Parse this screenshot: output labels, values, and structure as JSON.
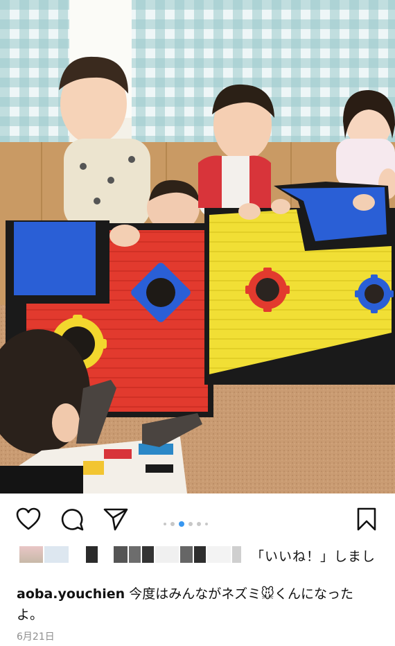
{
  "post": {
    "username": "aoba.youchien",
    "caption": "今度はみんながネズミ🐭くんになったよ。",
    "likes_text": "「いいね！」しまし",
    "date": "6月21日"
  },
  "carousel": {
    "count": 6,
    "active_index": 2
  },
  "icons": {
    "like": "heart-icon",
    "comment": "comment-icon",
    "share": "send-icon",
    "save": "bookmark-icon"
  },
  "colors": {
    "accent": "#3897f0",
    "text": "#111111",
    "muted": "#8e8e8e",
    "box_red": "#e23a2e",
    "box_yellow": "#f2e23a",
    "box_blue": "#2a5fd6"
  }
}
